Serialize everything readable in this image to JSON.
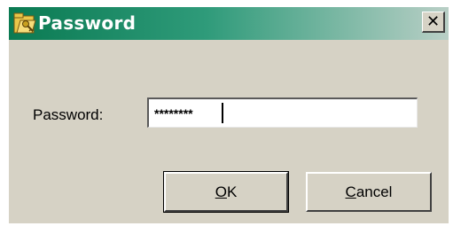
{
  "window": {
    "title": "Password",
    "title_icon": "folder-key-icon",
    "close_glyph": "✕"
  },
  "form": {
    "password_label": "Password:",
    "password_value": "********"
  },
  "buttons": {
    "ok_mnemonic": "O",
    "ok_rest": "K",
    "cancel_mnemonic": "C",
    "cancel_rest": "ancel"
  },
  "colors": {
    "titlebar_start": "#0a7a52",
    "titlebar_end": "#b9cfc6",
    "dialog_bg": "#d6d2c5"
  }
}
